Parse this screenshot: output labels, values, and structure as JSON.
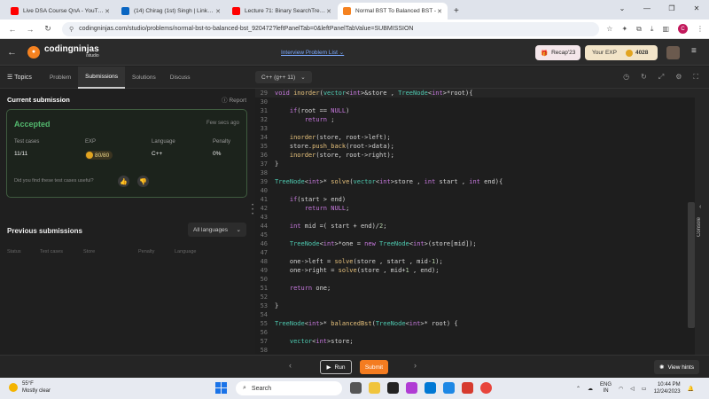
{
  "browser": {
    "tabs": [
      {
        "title": "Live DSA Course QnA - YouTube",
        "color": "#ff0000"
      },
      {
        "title": "(14) Chirag (1st) Singh | LinkedIn",
        "color": "#0a66c2"
      },
      {
        "title": "Lecture 71: Binary SearchTree &",
        "color": "#ff0000"
      },
      {
        "title": "Normal BST To Balanced BST -",
        "color": "#f58220"
      }
    ],
    "new_tab": "+",
    "url": "codingninjas.com/studio/problems/normal-bst-to-balanced-bst_920472?leftPanelTab=0&leftPanelTabValue=SUBMISSION",
    "profile_initial": "C"
  },
  "app": {
    "logo_text": "codingninjas",
    "logo_sub": "/studio",
    "interview_list": "Interview Problem List",
    "recap": "Recap'23",
    "your_exp_label": "Your EXP",
    "your_exp_value": "4028"
  },
  "toolbar": {
    "topics": "Topics",
    "tabs": [
      "Problem",
      "Submissions",
      "Solutions",
      "Discuss"
    ],
    "language": "C++ (g++ 11)"
  },
  "submission": {
    "header": "Current submission",
    "report": "Report",
    "status": "Accepted",
    "time": "Few secs ago",
    "test_cases_label": "Test cases",
    "test_cases_value": "11/11",
    "exp_label": "EXP",
    "exp_value": "80/80",
    "language_label": "Language",
    "language_value": "C++",
    "penalty_label": "Penalty",
    "penalty_value": "0%",
    "question": "Did you find these test cases useful?"
  },
  "previous": {
    "title": "Previous submissions",
    "filter": "All languages",
    "columns": [
      "Status",
      "Test cases",
      "Store",
      "Penalty",
      "Language"
    ]
  },
  "code_lines": [
    {
      "n": "29",
      "t": "void inorder(vector<int>&store , TreeNode<int>*root){"
    },
    {
      "n": "30",
      "t": ""
    },
    {
      "n": "31",
      "t": "    if(root == NULL)"
    },
    {
      "n": "32",
      "t": "        return ;"
    },
    {
      "n": "33",
      "t": ""
    },
    {
      "n": "34",
      "t": "    inorder(store, root->left);"
    },
    {
      "n": "35",
      "t": "    store.push_back(root->data);"
    },
    {
      "n": "36",
      "t": "    inorder(store, root->right);"
    },
    {
      "n": "37",
      "t": "}"
    },
    {
      "n": "38",
      "t": ""
    },
    {
      "n": "39",
      "t": "TreeNode<int>* solve(vector<int>store , int start , int end){"
    },
    {
      "n": "40",
      "t": ""
    },
    {
      "n": "41",
      "t": "    if(start > end)"
    },
    {
      "n": "42",
      "t": "        return NULL;"
    },
    {
      "n": "43",
      "t": ""
    },
    {
      "n": "44",
      "t": "    int mid =( start + end)/2;"
    },
    {
      "n": "45",
      "t": ""
    },
    {
      "n": "46",
      "t": "    TreeNode<int>*one = new TreeNode<int>(store[mid]);"
    },
    {
      "n": "47",
      "t": ""
    },
    {
      "n": "48",
      "t": "    one->left = solve(store , start , mid-1);"
    },
    {
      "n": "49",
      "t": "    one->right = solve(store , mid+1 , end);"
    },
    {
      "n": "50",
      "t": ""
    },
    {
      "n": "51",
      "t": "    return one;"
    },
    {
      "n": "52",
      "t": ""
    },
    {
      "n": "53",
      "t": "}"
    },
    {
      "n": "54",
      "t": ""
    },
    {
      "n": "55",
      "t": "TreeNode<int>* balancedBst(TreeNode<int>* root) {"
    },
    {
      "n": "56",
      "t": ""
    },
    {
      "n": "57",
      "t": "    vector<int>store;"
    },
    {
      "n": "58",
      "t": ""
    }
  ],
  "console_label": "Console",
  "bottom": {
    "run": "Run",
    "submit": "Submit",
    "hints": "View hints"
  },
  "taskbar": {
    "temp": "55°F",
    "weather": "Mostly clear",
    "search": "Search",
    "lang1": "ENG",
    "lang2": "IN",
    "time": "10:44 PM",
    "date": "12/24/2023"
  }
}
